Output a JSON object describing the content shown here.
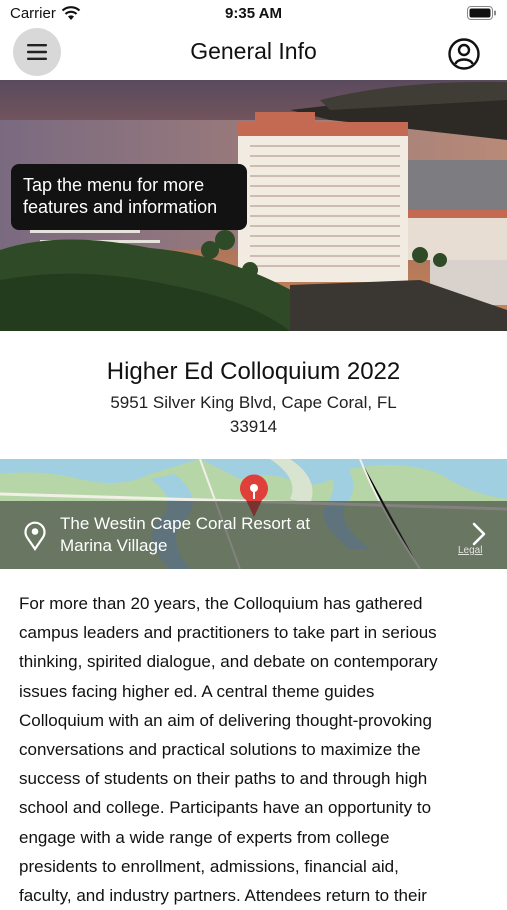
{
  "status_bar": {
    "carrier": "Carrier",
    "time": "9:35 AM"
  },
  "nav": {
    "title": "General Info"
  },
  "tooltip": {
    "line1": "Tap the menu for more",
    "line2": "features and information"
  },
  "event": {
    "title": "Higher Ed Colloquium 2022",
    "address_line1": "5951 Silver King Blvd, Cape Coral, FL",
    "address_line2": "33914"
  },
  "map": {
    "venue_line1": "The Westin Cape Coral Resort at",
    "venue_line2": "Marina Village",
    "legal": "Legal"
  },
  "description": {
    "lines": [
      "For more than 20 years, the Colloquium has gathered",
      "campus leaders and practitioners to take part in serious",
      "thinking, spirited dialogue, and debate on contemporary",
      "issues facing higher ed. A central theme guides",
      "Colloquium with an aim of delivering thought-provoking",
      "conversations and practical solutions to maximize the",
      "success of students on their paths to and through high",
      "school and college. Participants have an opportunity to",
      "engage with a wide range of experts from college",
      "presidents to enrollment, admissions, financial aid,",
      "faculty, and industry partners. Attendees return to their"
    ]
  },
  "colors": {
    "map_pin": "#e0403a",
    "tooltip_bg": "#121212",
    "menu_button_bg": "#d8d8d8"
  }
}
